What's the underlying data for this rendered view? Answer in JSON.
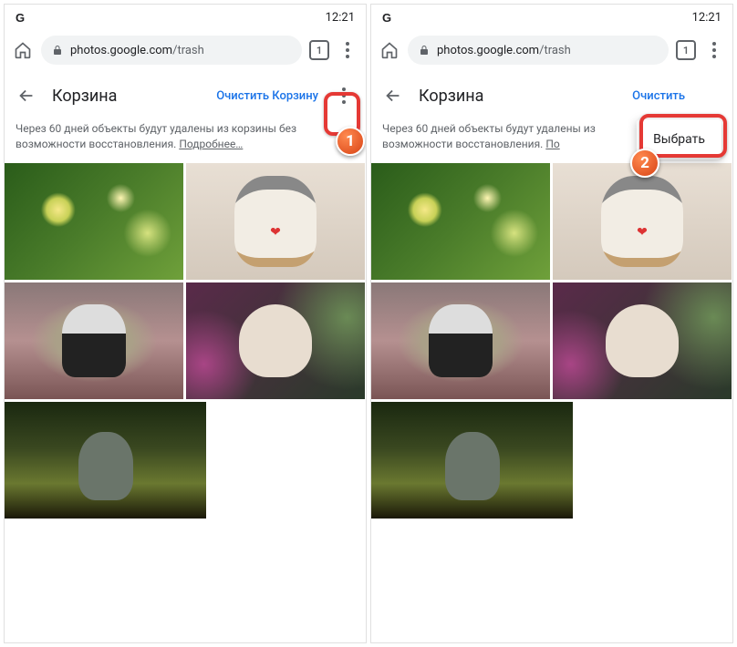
{
  "statusbar": {
    "logo": "G",
    "time": "12:21"
  },
  "browser": {
    "url_domain": "photos.google.com",
    "url_path": "/trash",
    "tab_count": "1"
  },
  "app": {
    "title": "Корзина",
    "clear_label": "Очистить Корзину",
    "clear_label_truncated": "Очистить",
    "notice_text": "Через 60 дней объекты будут удалены из корзины без возможности восстановления. ",
    "notice_text_truncated": "Через 60 дней объекты будут удалены из ",
    "notice_text_line2": "возможности восстановления. ",
    "more_link": "Подробнее…",
    "more_link_short": "По"
  },
  "popup": {
    "select_label": "Выбрать"
  },
  "steps": {
    "one": "1",
    "two": "2"
  }
}
